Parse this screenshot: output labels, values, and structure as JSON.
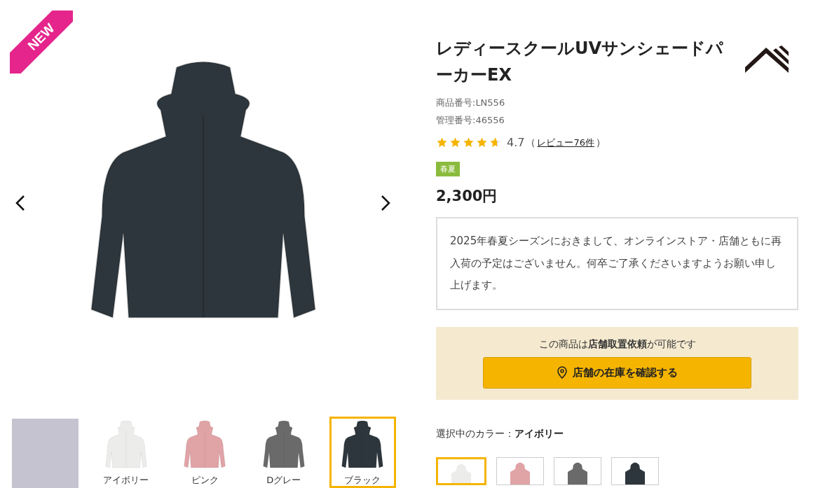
{
  "gallery": {
    "badge": "NEW",
    "main_image": {
      "color": "#2d363c"
    },
    "thumbnails": [
      {
        "kind": "photo",
        "selected": false
      },
      {
        "kind": "color",
        "label": "アイボリー",
        "color": "#ececea",
        "selected": false
      },
      {
        "kind": "color",
        "label": "ピンク",
        "color": "#e0a3a6",
        "selected": false
      },
      {
        "kind": "color",
        "label": "Dグレー",
        "color": "#6a6a6a",
        "selected": false
      },
      {
        "kind": "color",
        "label": "ブラック",
        "color": "#2d363c",
        "selected": true
      }
    ]
  },
  "product": {
    "title": "レディースクールUVサンシェードパーカーEX",
    "product_number": "商品番号:LN556",
    "management_number": "管理番号:46556",
    "rating": {
      "stars": 4.7,
      "score": "4.7",
      "open_paren": "（",
      "reviews_link": "レビュー76件",
      "close_paren": "）"
    },
    "season_tag": "春夏",
    "price": "2,300円",
    "notice": "2025年春夏シーズンにおきまして、オンラインストア・店舗ともに再入荷の予定はございません。何卒ご了承くださいますようお願い申し上げます。",
    "store_box": {
      "text": "この商品は**店舗取置依頼**が可能です",
      "button": "店舗の在庫を確認する"
    },
    "color_selection": {
      "label": "選択中のカラー：",
      "value": "アイボリー",
      "swatches": [
        {
          "color": "#ececea",
          "selected": true
        },
        {
          "color": "#e0a3a6",
          "selected": false
        },
        {
          "color": "#6a6a6a",
          "selected": false
        },
        {
          "color": "#2d363c",
          "selected": false
        }
      ]
    }
  }
}
